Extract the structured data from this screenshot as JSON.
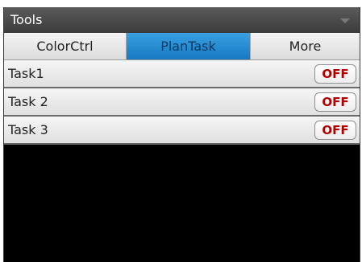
{
  "panel": {
    "title": "Tools",
    "collapse_icon": "chevron-down-icon"
  },
  "tabs": [
    {
      "label": "ColorCtrl",
      "active": false
    },
    {
      "label": "PlanTask",
      "active": true
    },
    {
      "label": "More",
      "active": false
    }
  ],
  "tasks": [
    {
      "label": "Task1",
      "toggle": "OFF"
    },
    {
      "label": "Task 2",
      "toggle": "OFF"
    },
    {
      "label": "Task 3",
      "toggle": "OFF"
    }
  ],
  "colors": {
    "active_tab": "#1779c2",
    "toggle_text": "#b00000",
    "panel_bg": "#000000"
  }
}
